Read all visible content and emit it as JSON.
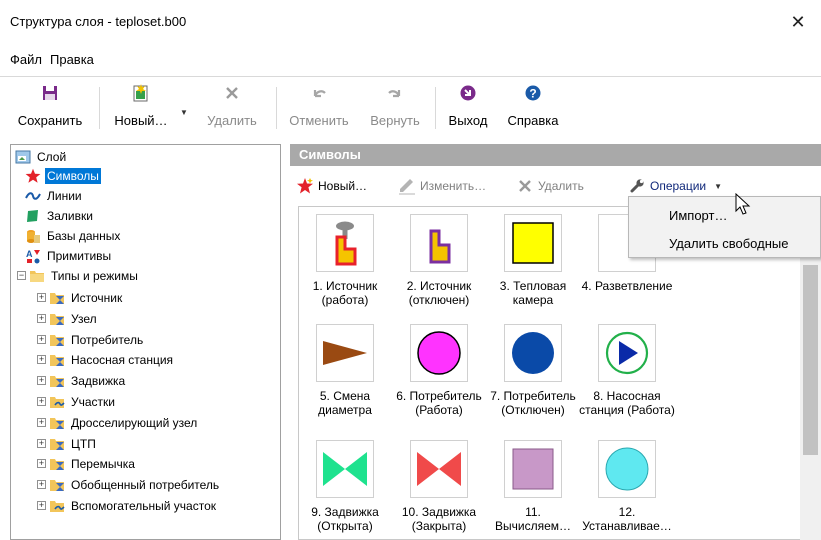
{
  "window": {
    "title": "Структура слоя - teploset.b00",
    "close_glyph": "✕"
  },
  "menu": [
    "Файл",
    "Правка"
  ],
  "toolbar": {
    "save": "Сохранить",
    "new": "Новый…",
    "delete": "Удалить",
    "undo": "Отменить",
    "redo": "Вернуть",
    "exit": "Выход",
    "help": "Справка"
  },
  "tree": {
    "root": "Слой",
    "children": [
      "Символы",
      "Линии",
      "Заливки",
      "Базы данных",
      "Примитивы"
    ],
    "types": {
      "label": "Типы и режимы",
      "items": [
        "Источник",
        "Узел",
        "Потребитель",
        "Насосная станция",
        "Задвижка",
        "Участки",
        "Дросселирующий узел",
        "ЦТП",
        "Перемычка",
        "Обобщенный потребитель",
        "Вспомогательный участок"
      ]
    }
  },
  "panel": {
    "title": "Символы",
    "new": "Новый…",
    "edit": "Изменить…",
    "delete": "Удалить",
    "operations": "Операции"
  },
  "dropdown": {
    "import": "Импорт…",
    "remove_free": "Удалить свободные"
  },
  "symbols": [
    {
      "caption": "1. Источник\n(работа)",
      "icon": "source-working-icon"
    },
    {
      "caption": "2. Источник\n(отключен)",
      "icon": "source-off-icon"
    },
    {
      "caption": "3. Тепловая\nкамера",
      "icon": "yellow-square-icon"
    },
    {
      "caption": "4. Разветвление",
      "icon": "branch-icon"
    },
    {
      "caption": "5. Смена\nдиаметра",
      "icon": "diameter-change-icon"
    },
    {
      "caption": "6. Потребитель\n(Работа)",
      "icon": "magenta-circle-icon"
    },
    {
      "caption": "7. Потребитель\n(Отключен)",
      "icon": "blue-circle-icon"
    },
    {
      "caption": "8. Насосная\nстанция (Работа)",
      "icon": "pump-station-icon"
    },
    {
      "caption": "9. Задвижка\n(Открыта)",
      "icon": "valve-open-icon"
    },
    {
      "caption": "10. Задвижка\n(Закрыта)",
      "icon": "valve-closed-icon"
    },
    {
      "caption": "11.\nВычисляем…",
      "icon": "purple-square-icon"
    },
    {
      "caption": "12.\nУстанавливае…",
      "icon": "cyan-circle-icon"
    }
  ],
  "colors": {
    "selection": "#0078d7",
    "panel_header": "#a9a9a9",
    "source_red": "#e8212b",
    "source_yellow": "#f5c400",
    "source_purple": "#7b2fa0",
    "yellow": "#ffff00",
    "magenta": "#ff33ff",
    "blue": "#0a4aa8",
    "green": "#1ee28e",
    "red": "#f04a4a",
    "purple_square": "#c898c8",
    "cyan": "#5fe8f0",
    "brown": "#9a4a12"
  }
}
